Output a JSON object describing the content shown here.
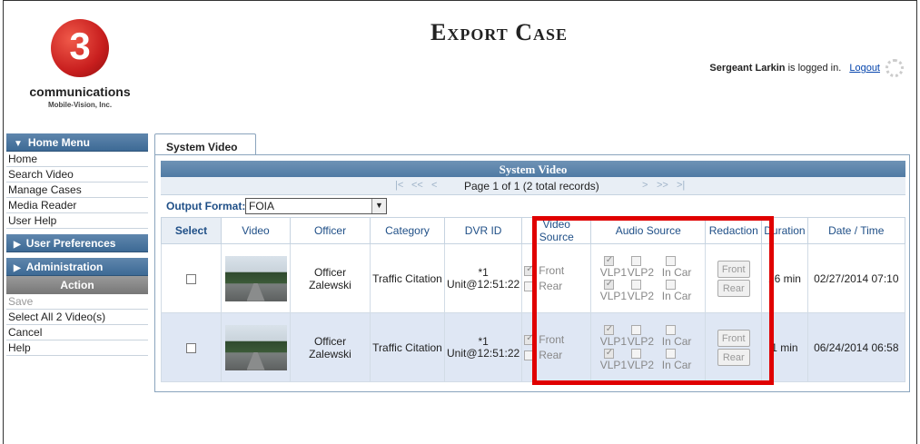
{
  "header": {
    "logo_mark": "3",
    "logo_name": "communications",
    "logo_sub": "Mobile-Vision, Inc.",
    "title": "Export Case",
    "user": "Sergeant Larkin",
    "logged_in_text": "is logged in.",
    "logout": "Logout"
  },
  "sidebar": {
    "home_menu": "Home Menu",
    "items": [
      "Home",
      "Search Video",
      "Manage Cases",
      "Media Reader",
      "User Help"
    ],
    "user_prefs": "User Preferences",
    "administration": "Administration",
    "action": "Action",
    "actions": [
      "Save",
      "Select All 2 Video(s)",
      "Cancel",
      "Help"
    ]
  },
  "tab": {
    "label": "System Video"
  },
  "grid": {
    "title": "System Video",
    "pager_first": "|<",
    "pager_prev_page": "<<",
    "pager_prev": "<",
    "pager_next": ">",
    "pager_next_page": ">>",
    "pager_last": ">|",
    "page_text": "Page 1 of 1 (2 total records)",
    "output_format_label": "Output Format:",
    "output_format_value": "FOIA",
    "columns": [
      "Select",
      "Video",
      "Officer",
      "Category",
      "DVR ID",
      "Video Source",
      "Audio Source",
      "Redaction",
      "Duration",
      "Date / Time"
    ],
    "rows": [
      {
        "officer": "Officer Zalewski",
        "category": "Traffic Citation",
        "dvr_line1": "*1",
        "dvr_line2": "Unit@12:51:22",
        "front": "Front",
        "rear": "Rear",
        "vlp1": "VLP1",
        "vlp2": "VLP2",
        "incar": "In Car",
        "red_front": "Front",
        "red_rear": "Rear",
        "duration": "16 min",
        "datetime": "02/27/2014 07:10"
      },
      {
        "officer": "Officer Zalewski",
        "category": "Traffic Citation",
        "dvr_line1": "*1",
        "dvr_line2": "Unit@12:51:22",
        "front": "Front",
        "rear": "Rear",
        "vlp1": "VLP1",
        "vlp2": "VLP2",
        "incar": "In Car",
        "red_front": "Front",
        "red_rear": "Rear",
        "duration": "1 min",
        "datetime": "06/24/2014 06:58"
      }
    ]
  },
  "colors": {
    "highlight": "#e00000",
    "menu_header": "#4a76a0",
    "row_alt": "#dfe7f4"
  }
}
